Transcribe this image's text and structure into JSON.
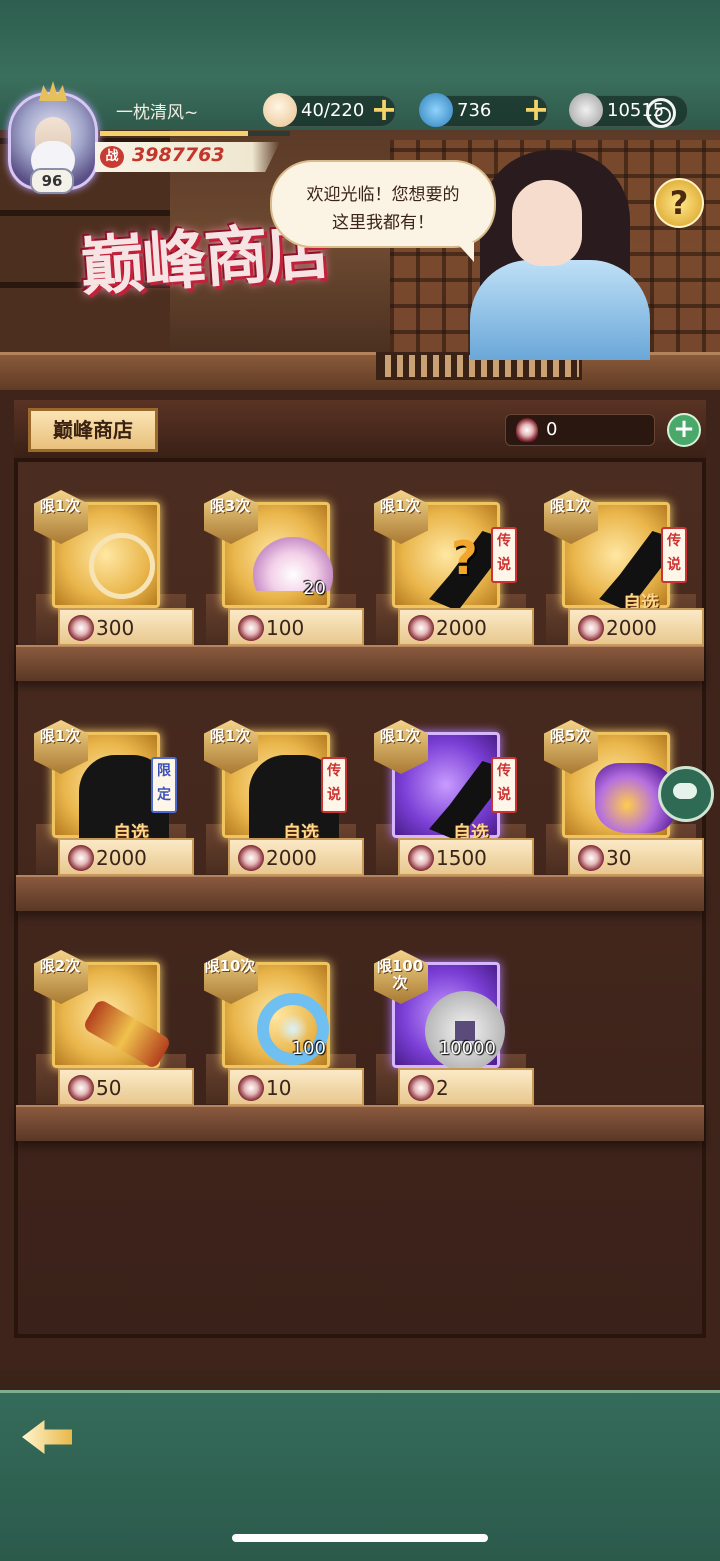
{
  "player": {
    "name": "一枕清风~",
    "level": "96",
    "power_label": "战",
    "power": "3987763",
    "exp_progress": 0.78
  },
  "currencies": [
    {
      "icon": "steamed-bun-icon",
      "value": "40/220"
    },
    {
      "icon": "spiral-token-icon",
      "value": "736"
    },
    {
      "icon": "silver-coin-icon",
      "value": "10515"
    }
  ],
  "banner": {
    "title": "巅峰商店",
    "speech_line1": "欢迎光临！您想要的",
    "speech_line2": "这里我都有！",
    "help_label": "?"
  },
  "shop": {
    "tab_label": "巅峰商店",
    "token_count": "0"
  },
  "items": [
    {
      "limit": "限1次",
      "price": "300",
      "qty": "",
      "tag": "",
      "pick": "",
      "art": "ring"
    },
    {
      "limit": "限3次",
      "price": "100",
      "qty": "20",
      "tag": "",
      "pick": "",
      "art": "lotus"
    },
    {
      "limit": "限1次",
      "price": "2000",
      "qty": "",
      "tag": "传说",
      "pick": "",
      "art": "mystery-weapon"
    },
    {
      "limit": "限1次",
      "price": "2000",
      "qty": "",
      "tag": "传说",
      "pick": "自选",
      "art": "weapon-silhouette"
    },
    {
      "limit": "限1次",
      "price": "2000",
      "qty": "",
      "tag": "限定",
      "pick": "自选",
      "art": "hero-silhouette"
    },
    {
      "limit": "限1次",
      "price": "2000",
      "qty": "",
      "tag": "传说",
      "pick": "自选",
      "art": "hero-silhouette"
    },
    {
      "limit": "限1次",
      "price": "1500",
      "qty": "",
      "tag": "传说",
      "pick": "自选",
      "art": "weapon-silhouette"
    },
    {
      "limit": "限5次",
      "price": "30",
      "qty": "",
      "tag": "",
      "pick": "",
      "art": "purple-gem"
    },
    {
      "limit": "限2次",
      "price": "50",
      "qty": "",
      "tag": "",
      "pick": "",
      "art": "scroll"
    },
    {
      "limit": "限10次",
      "price": "10",
      "qty": "100",
      "tag": "",
      "pick": "",
      "art": "jade-pendant"
    },
    {
      "limit": "限100次",
      "price": "2",
      "qty": "10000",
      "tag": "",
      "pick": "",
      "art": "silver-coin"
    }
  ],
  "colors": {
    "top_band": "#2d5e4f",
    "card_gold": "#f0c45f",
    "card_purple": "#7b3fd6",
    "legend_tag": "#cc3333"
  }
}
